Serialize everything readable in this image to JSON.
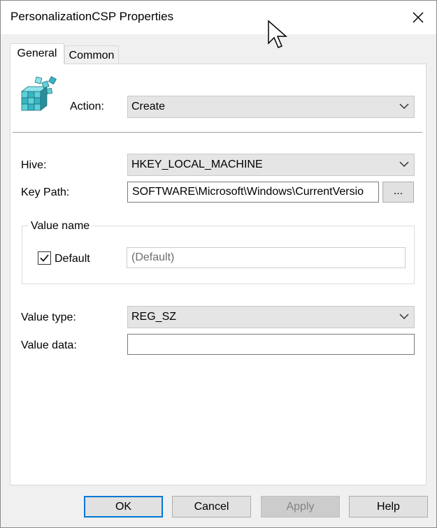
{
  "window": {
    "title": "PersonalizationCSP Properties"
  },
  "tabs": [
    {
      "label": "General",
      "selected": true
    },
    {
      "label": "Common",
      "selected": false
    }
  ],
  "icons": {
    "app": "registry-icon",
    "close": "close-icon",
    "cursor": "mouse-pointer-icon",
    "dropdown": "chevron-down-icon"
  },
  "general": {
    "action": {
      "label": "Action:",
      "value": "Create"
    },
    "hive": {
      "label": "Hive:",
      "value": "HKEY_LOCAL_MACHINE"
    },
    "key_path": {
      "label": "Key Path:",
      "value": "SOFTWARE\\Microsoft\\Windows\\CurrentVersio",
      "browse_label": "..."
    },
    "value_name": {
      "group_title": "Value name",
      "default_checkbox_label": "Default",
      "default_checked": true,
      "value": "(Default)"
    },
    "value_type": {
      "label": "Value type:",
      "value": "REG_SZ"
    },
    "value_data": {
      "label": "Value data:",
      "value": ""
    }
  },
  "buttons": {
    "ok": "OK",
    "cancel": "Cancel",
    "apply": "Apply",
    "help": "Help"
  },
  "colors": {
    "accent": "#0078d7",
    "window_bg": "#f0f0f0",
    "panel_bg": "#ffffff"
  }
}
